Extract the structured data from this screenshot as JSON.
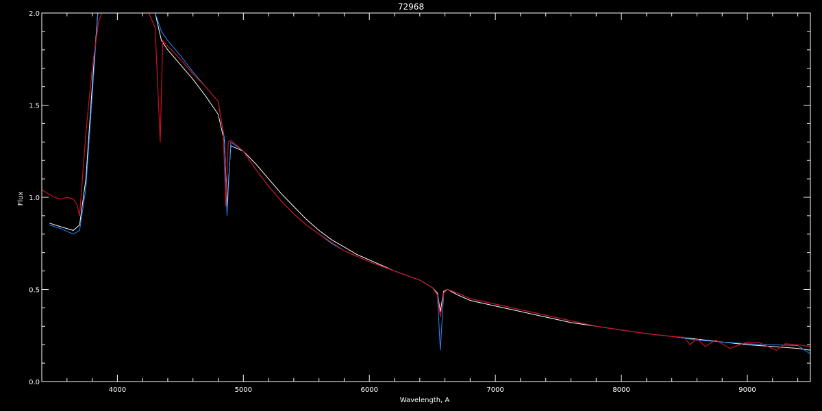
{
  "chart_data": {
    "type": "line",
    "title": "72968",
    "xlabel": "Wavelength, A",
    "ylabel": "Flux",
    "xlim": [
      3400,
      9500
    ],
    "ylim": [
      0.0,
      2.0
    ],
    "x_major_ticks": [
      4000,
      5000,
      6000,
      7000,
      8000,
      9000
    ],
    "x_tick_labels": [
      "4000",
      "5000",
      "6000",
      "7000",
      "8000",
      "9000"
    ],
    "y_major_ticks": [
      0.0,
      0.5,
      1.0,
      1.5,
      2.0
    ],
    "y_tick_labels": [
      "0.0",
      "0.5",
      "1.0",
      "1.5",
      "2.0"
    ],
    "grid": false,
    "background": "#000000",
    "series": [
      {
        "role": "observed-spectrum-white",
        "color": "#ffffff",
        "x": [
          3460,
          3550,
          3650,
          3700,
          3750,
          3800,
          3850,
          3900,
          4000,
          4100,
          4200,
          4300,
          4350,
          4400,
          4500,
          4600,
          4700,
          4750,
          4800,
          4850,
          4870,
          4900,
          5000,
          5100,
          5200,
          5300,
          5400,
          5500,
          5600,
          5700,
          5800,
          5900,
          6000,
          6200,
          6400,
          6500,
          6540,
          6563,
          6590,
          6620,
          6700,
          6800,
          7000,
          7200,
          7400,
          7600,
          7800,
          8000,
          8200,
          8400,
          8600,
          8800,
          9000,
          9200,
          9400,
          9500
        ],
        "y": [
          0.86,
          0.84,
          0.82,
          0.85,
          1.1,
          1.6,
          2.05,
          2.05,
          2.05,
          2.05,
          2.05,
          2.0,
          1.85,
          1.8,
          1.72,
          1.64,
          1.55,
          1.5,
          1.45,
          1.3,
          0.95,
          1.28,
          1.25,
          1.18,
          1.1,
          1.02,
          0.95,
          0.88,
          0.82,
          0.77,
          0.73,
          0.69,
          0.66,
          0.6,
          0.55,
          0.51,
          0.48,
          0.38,
          0.49,
          0.5,
          0.47,
          0.44,
          0.41,
          0.38,
          0.35,
          0.32,
          0.3,
          0.28,
          0.26,
          0.245,
          0.23,
          0.215,
          0.2,
          0.19,
          0.18,
          0.17
        ]
      },
      {
        "role": "observed-spectrum-blue",
        "color": "#1e8cff",
        "x": [
          3460,
          3550,
          3650,
          3700,
          3750,
          3800,
          3850,
          3900,
          4000,
          4100,
          4200,
          4300,
          4350,
          4400,
          4500,
          4600,
          4700,
          4750,
          4800,
          4850,
          4870,
          4900,
          5000,
          5100,
          5200,
          5300,
          5400,
          5500,
          5600,
          5700,
          5800,
          5900,
          6000,
          6200,
          6400,
          6500,
          6540,
          6563,
          6590,
          6620,
          6700,
          6800,
          7000,
          7200,
          7400,
          7600,
          7800,
          8000,
          8200,
          8400,
          8600,
          8800,
          9000,
          9200,
          9400,
          9500
        ],
        "y": [
          0.85,
          0.83,
          0.8,
          0.82,
          1.05,
          1.55,
          2.05,
          2.05,
          2.05,
          2.05,
          2.05,
          2.0,
          1.9,
          1.85,
          1.77,
          1.68,
          1.6,
          1.56,
          1.52,
          1.32,
          0.9,
          1.3,
          1.25,
          1.15,
          1.06,
          0.98,
          0.91,
          0.85,
          0.8,
          0.75,
          0.71,
          0.68,
          0.65,
          0.6,
          0.55,
          0.51,
          0.47,
          0.17,
          0.48,
          0.5,
          0.48,
          0.45,
          0.42,
          0.39,
          0.36,
          0.33,
          0.3,
          0.28,
          0.26,
          0.245,
          0.225,
          0.215,
          0.205,
          0.2,
          0.195,
          0.15
        ]
      },
      {
        "role": "model-spectrum-red",
        "color": "#d01020",
        "x": [
          3400,
          3450,
          3500,
          3550,
          3600,
          3650,
          3680,
          3700,
          3750,
          3800,
          3850,
          3900,
          3950,
          4000,
          4050,
          4100,
          4150,
          4200,
          4250,
          4300,
          4340,
          4360,
          4400,
          4500,
          4600,
          4700,
          4800,
          4840,
          4861,
          4880,
          4900,
          5000,
          5100,
          5200,
          5300,
          5400,
          5500,
          5600,
          5800,
          6000,
          6200,
          6400,
          6500,
          6540,
          6563,
          6590,
          6620,
          6700,
          6800,
          7000,
          7200,
          7400,
          7600,
          7800,
          8000,
          8200,
          8400,
          8500,
          8545,
          8600,
          8665,
          8750,
          8863,
          9000,
          9100,
          9230,
          9300,
          9400,
          9500
        ],
        "y": [
          1.04,
          1.02,
          1.0,
          0.99,
          1.0,
          0.99,
          0.96,
          0.9,
          1.35,
          1.7,
          1.95,
          2.05,
          2.05,
          2.05,
          2.05,
          2.05,
          2.05,
          2.05,
          2.0,
          1.92,
          1.3,
          1.85,
          1.82,
          1.75,
          1.67,
          1.6,
          1.52,
          1.35,
          0.95,
          1.3,
          1.31,
          1.25,
          1.15,
          1.06,
          0.98,
          0.91,
          0.85,
          0.8,
          0.71,
          0.65,
          0.6,
          0.55,
          0.51,
          0.47,
          0.35,
          0.48,
          0.5,
          0.48,
          0.45,
          0.42,
          0.39,
          0.36,
          0.33,
          0.3,
          0.28,
          0.26,
          0.245,
          0.24,
          0.2,
          0.235,
          0.19,
          0.225,
          0.18,
          0.215,
          0.21,
          0.17,
          0.205,
          0.2,
          0.19
        ]
      }
    ]
  }
}
